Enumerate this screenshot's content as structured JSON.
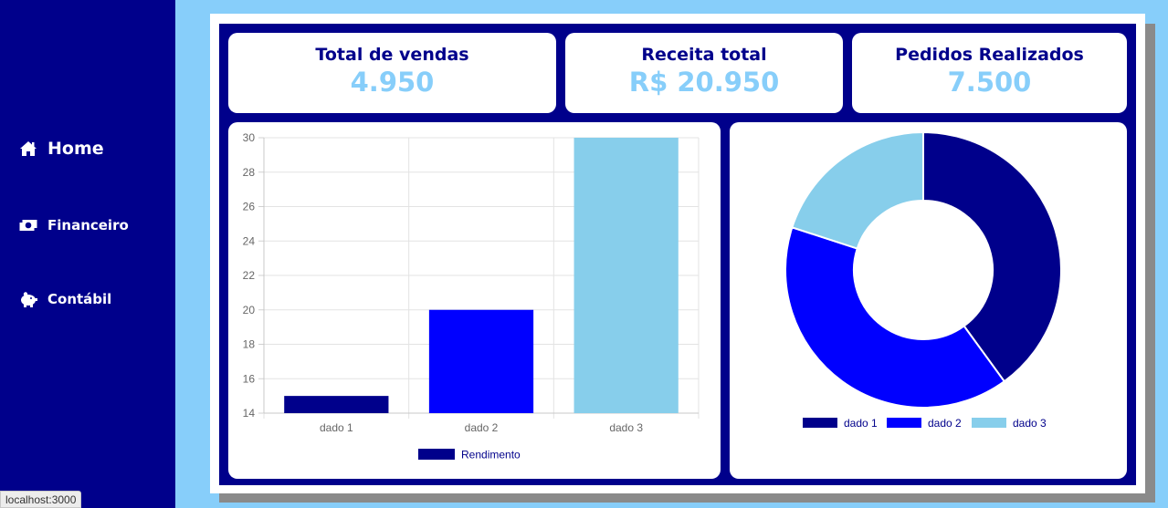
{
  "sidebar": {
    "items": [
      {
        "label": "Home",
        "icon": "home-icon"
      },
      {
        "label": "Financeiro",
        "icon": "money-bill-icon"
      },
      {
        "label": "Contábil",
        "icon": "piggy-bank-icon"
      }
    ]
  },
  "kpis": [
    {
      "title": "Total de vendas",
      "value": "4.950"
    },
    {
      "title": "Receita total",
      "value": "R$ 20.950"
    },
    {
      "title": "Pedidos Realizados",
      "value": "7.500"
    }
  ],
  "colors": {
    "navy": "#00008b",
    "blue": "#0000ff",
    "light_blue": "#87cefa",
    "sky": "#87ceeb"
  },
  "status_bar": {
    "url": "localhost:3000"
  },
  "chart_data": [
    {
      "type": "bar",
      "categories": [
        "dado 1",
        "dado 2",
        "dado 3"
      ],
      "series": [
        {
          "name": "Rendimento",
          "values": [
            15,
            20,
            30
          ]
        }
      ],
      "bar_colors": [
        "#00008b",
        "#0000ff",
        "#87ceeb"
      ],
      "ylim": [
        14,
        30
      ],
      "yticks": [
        14,
        16,
        18,
        20,
        22,
        24,
        26,
        28,
        30
      ],
      "grid": true,
      "legend": "bottom"
    },
    {
      "type": "pie",
      "labels": [
        "dado 1",
        "dado 2",
        "dado 3"
      ],
      "values": [
        40,
        40,
        20
      ],
      "colors": [
        "#00008b",
        "#0000ff",
        "#87ceeb"
      ],
      "donut": true,
      "legend": "bottom"
    }
  ]
}
